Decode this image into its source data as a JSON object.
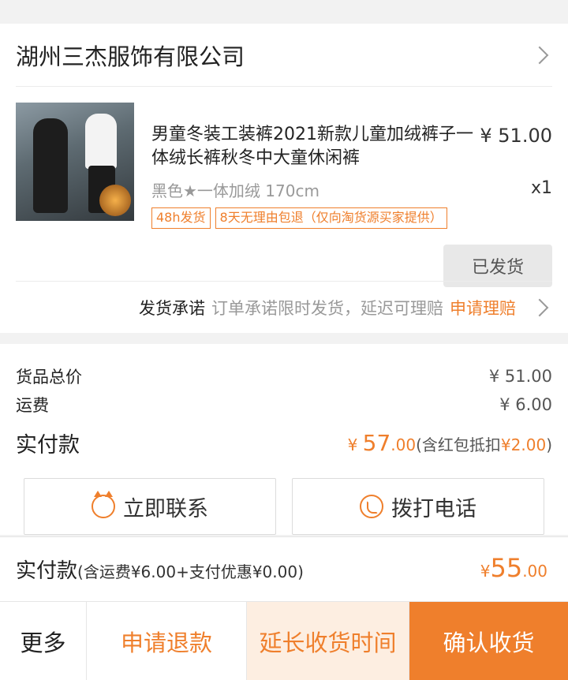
{
  "shop": {
    "name": "湖州三杰服饰有限公司"
  },
  "product": {
    "title": "男童冬装工装裤2021新款儿童加绒裤子一体绒长裤秋冬中大童休闲裤",
    "price": "¥ 51.00",
    "sku": "黑色★一体加绒 170cm",
    "quantity": "x1",
    "badges": [
      "48h发货",
      "8天无理由包退（仅向淘货源买家提供）"
    ],
    "status_button": "已发货"
  },
  "promise": {
    "title": "发货承诺",
    "description": "订单承诺限时发货，延迟可理赔",
    "link": "申请理赔"
  },
  "price_summary": {
    "goods_total_label": "货品总价",
    "goods_total_value": "¥ 51.00",
    "shipping_label": "运费",
    "shipping_value": "¥ 6.00",
    "paid_label": "实付款",
    "paid_currency": "¥ ",
    "paid_integer": "57",
    "paid_decimal": ".00",
    "paid_note_prefix": "(含红包抵扣",
    "paid_note_amount": "¥2.00",
    "paid_note_suffix": ")"
  },
  "actions": {
    "contact_label": "立即联系",
    "call_label": "拨打电话"
  },
  "total_bar": {
    "label": "实付款",
    "note": "(含运费¥6.00+支付优惠¥0.00)",
    "currency": "¥",
    "integer": "55",
    "decimal": ".00"
  },
  "bottom_actions": {
    "more": "更多",
    "refund": "申请退款",
    "extend": "延长收货时间",
    "confirm": "确认收货"
  },
  "colors": {
    "accent": "#ef7f2c",
    "accent_light": "#fdeee1",
    "background": "#f2f2f2"
  },
  "icons": [
    "chevron-right-icon",
    "chat-cat-icon",
    "phone-icon"
  ]
}
